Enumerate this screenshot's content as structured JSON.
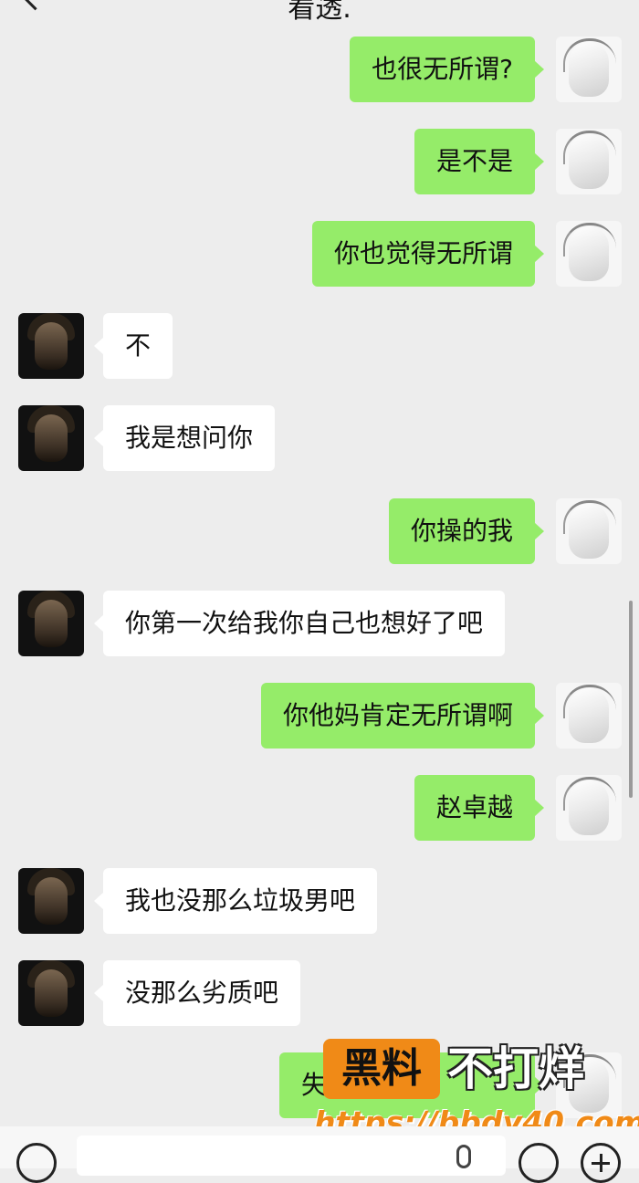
{
  "header": {
    "title": "看透."
  },
  "messages": [
    {
      "side": "me",
      "text": "也很无所谓?"
    },
    {
      "side": "me",
      "text": "是不是"
    },
    {
      "side": "me",
      "text": "你也觉得无所谓"
    },
    {
      "side": "other",
      "text": "不"
    },
    {
      "side": "other",
      "text": "我是想问你"
    },
    {
      "side": "me",
      "text": "你操的我"
    },
    {
      "side": "other",
      "text": "你第一次给我你自己也想好了吧"
    },
    {
      "side": "me",
      "text": "你他妈肯定无所谓啊"
    },
    {
      "side": "me",
      "text": "赵卓越"
    },
    {
      "side": "other",
      "text": "我也没那么垃圾男吧"
    },
    {
      "side": "other",
      "text": "没那么劣质吧"
    },
    {
      "side": "me",
      "text": "失去"
    }
  ],
  "watermark": {
    "brand": "黑料",
    "slogan": "不打烊",
    "url": "https://bbdy40.com"
  },
  "colors": {
    "background": "#ededed",
    "my_bubble": "#95ec69",
    "their_bubble": "#ffffff",
    "watermark_orange": "#f08a17"
  },
  "icons": {
    "back": "chevron-left-icon",
    "voice": "voice-icon",
    "mic": "microphone-icon",
    "emoji": "emoji-icon",
    "more": "plus-icon"
  }
}
